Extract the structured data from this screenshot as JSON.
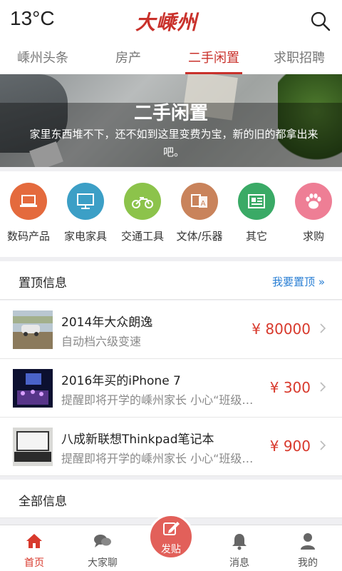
{
  "header": {
    "temperature": "13°C",
    "logo": "大嵊州",
    "search_icon": "search-icon"
  },
  "tabs": [
    {
      "label": "嵊州头条",
      "active": false
    },
    {
      "label": "房产",
      "active": false
    },
    {
      "label": "二手闲置",
      "active": true
    },
    {
      "label": "求职招聘",
      "active": false
    }
  ],
  "banner": {
    "title": "二手闲置",
    "subtitle": "家里东西堆不下，还不如到这里变费为宝，新的旧的都拿出来吧。"
  },
  "categories": [
    {
      "label": "数码产品",
      "icon": "laptop-icon",
      "color": "#e46a3d"
    },
    {
      "label": "家电家具",
      "icon": "monitor-icon",
      "color": "#3c9fc6"
    },
    {
      "label": "交通工具",
      "icon": "motorbike-icon",
      "color": "#8cc34b"
    },
    {
      "label": "文体/乐器",
      "icon": "translate-icon",
      "color": "#c9835b"
    },
    {
      "label": "其它",
      "icon": "news-icon",
      "color": "#3aaa66"
    },
    {
      "label": "求购",
      "icon": "paw-icon",
      "color": "#ee7e95"
    }
  ],
  "pinned": {
    "title": "置顶信息",
    "more_label": "我要置顶 »",
    "items": [
      {
        "name": "2014年大众朗逸",
        "desc": "自动档六级变速",
        "price": "¥ 80000"
      },
      {
        "name": "2016年买的iPhone 7",
        "desc": "提醒即将开学的嵊州家长 小心“班级…",
        "price": "¥ 300"
      },
      {
        "name": "八成新联想Thinkpad笔记本",
        "desc": "提醒即将开学的嵊州家长 小心“班级…",
        "price": "¥ 900"
      }
    ]
  },
  "all_info": {
    "title": "全部信息"
  },
  "bottom_nav": {
    "home": "首页",
    "chat": "大家聊",
    "post": "发贴",
    "messages": "消息",
    "mine": "我的"
  },
  "colors": {
    "accent": "#c9312b",
    "price": "#d8392c",
    "link": "#2a7fd4"
  }
}
